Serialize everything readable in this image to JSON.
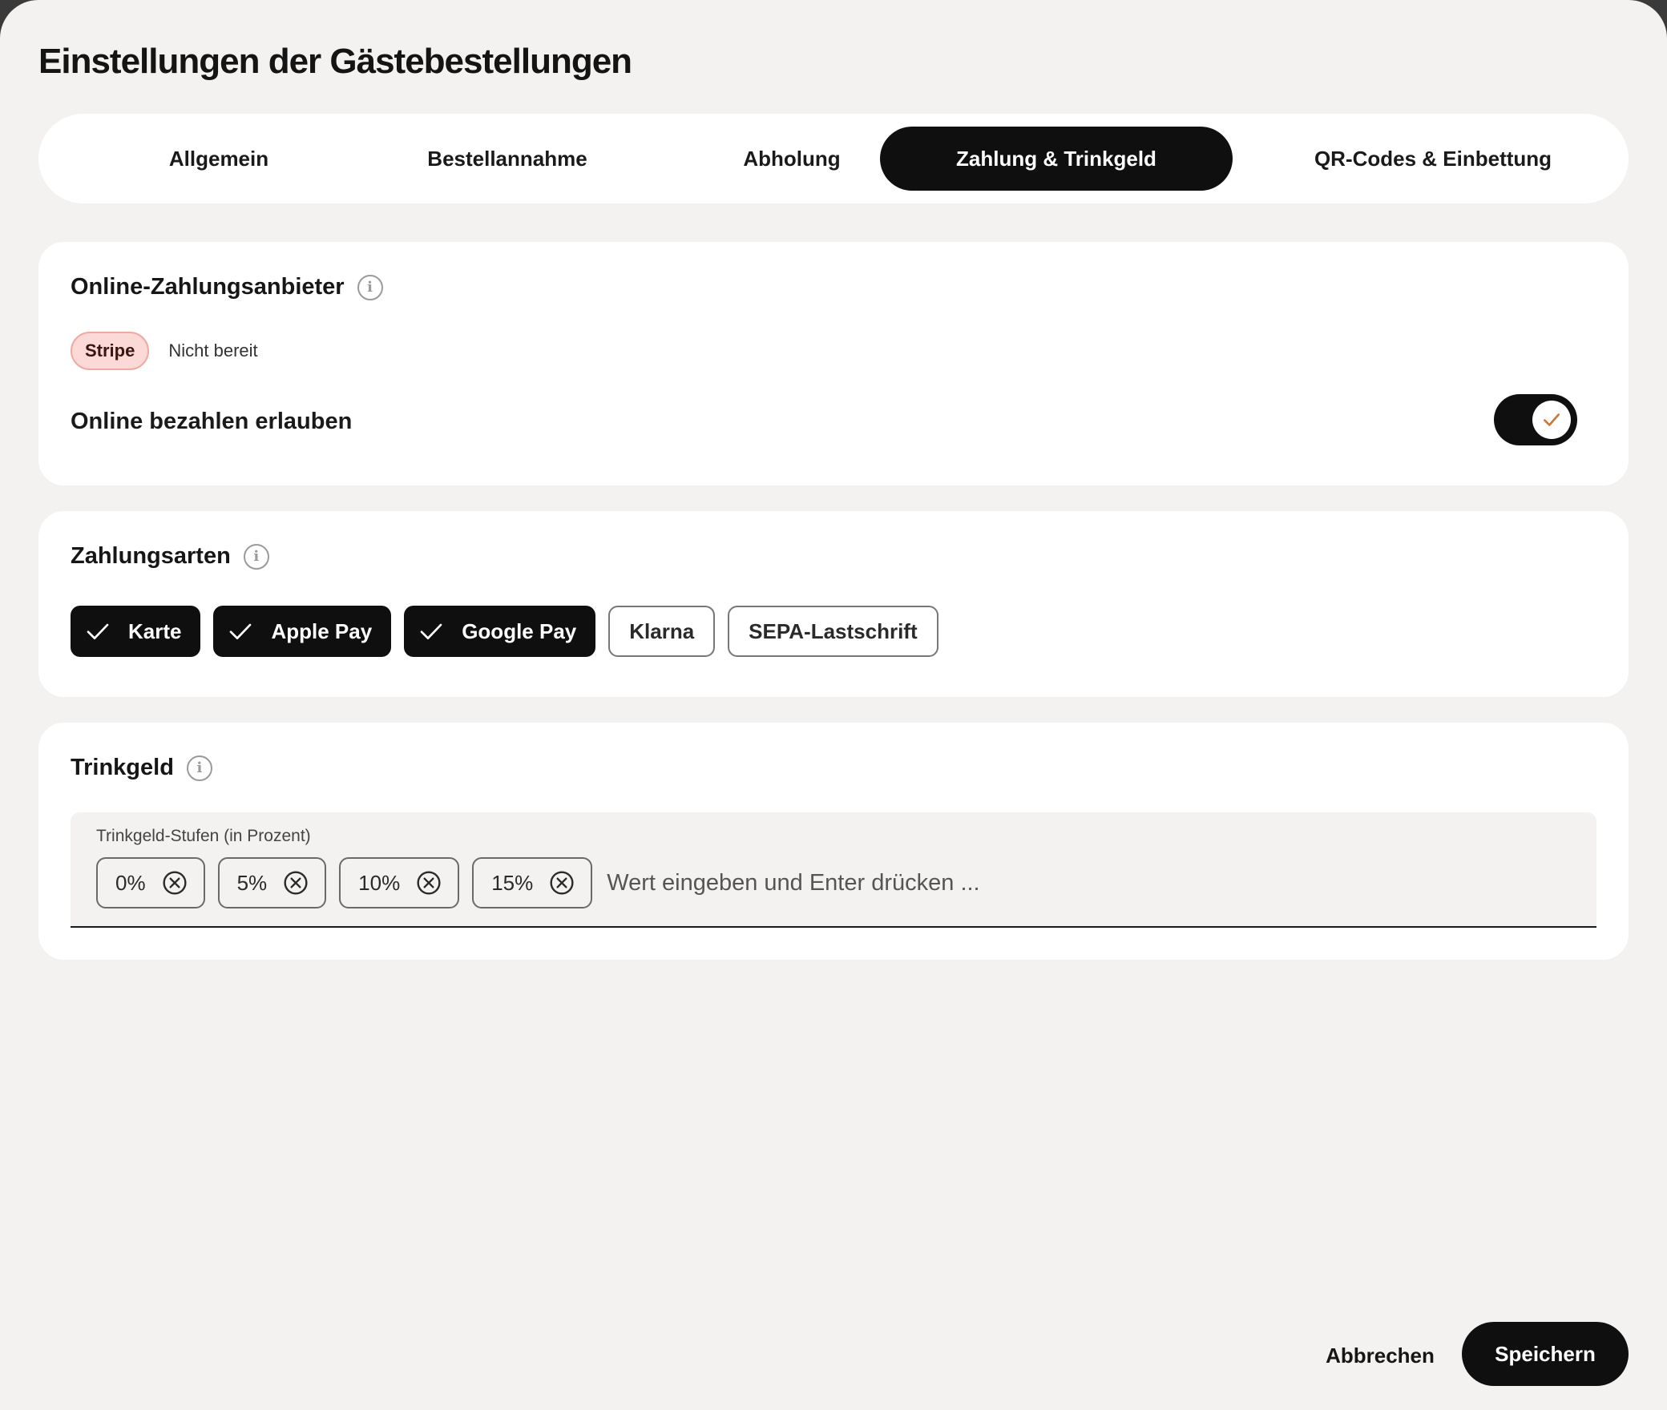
{
  "dialog": {
    "title": "Einstellungen der Gästebestellungen"
  },
  "tabs": [
    {
      "label": "Allgemein",
      "active": false
    },
    {
      "label": "Bestellannahme",
      "active": false
    },
    {
      "label": "Abholung",
      "active": false
    },
    {
      "label": "Zahlung & Trinkgeld",
      "active": true
    },
    {
      "label": "QR-Codes & Einbettung",
      "active": false
    }
  ],
  "provider": {
    "title": "Online-Zahlungsanbieter",
    "info_icon": "info-icon",
    "badge": "Stripe",
    "status": "Nicht bereit",
    "toggle_label": "Online bezahlen erlauben",
    "toggle_on": true,
    "toggle_check_color": "#c8773a"
  },
  "methods": {
    "title": "Zahlungsarten",
    "items": [
      {
        "label": "Karte",
        "selected": true
      },
      {
        "label": "Apple Pay",
        "selected": true
      },
      {
        "label": "Google Pay",
        "selected": true
      },
      {
        "label": "Klarna",
        "selected": false
      },
      {
        "label": "SEPA-Lastschrift",
        "selected": false
      }
    ]
  },
  "tips": {
    "title": "Trinkgeld",
    "field_label": "Trinkgeld-Stufen (in Prozent)",
    "values": [
      "0%",
      "5%",
      "10%",
      "15%"
    ],
    "placeholder": "Wert eingeben und Enter drücken ...",
    "value": ""
  },
  "footer": {
    "cancel": "Abbrechen",
    "save": "Speichern"
  },
  "colors": {
    "accent": "#0f0f0f",
    "background": "#f3f2f0",
    "badge_bg": "#fbd9d6"
  }
}
